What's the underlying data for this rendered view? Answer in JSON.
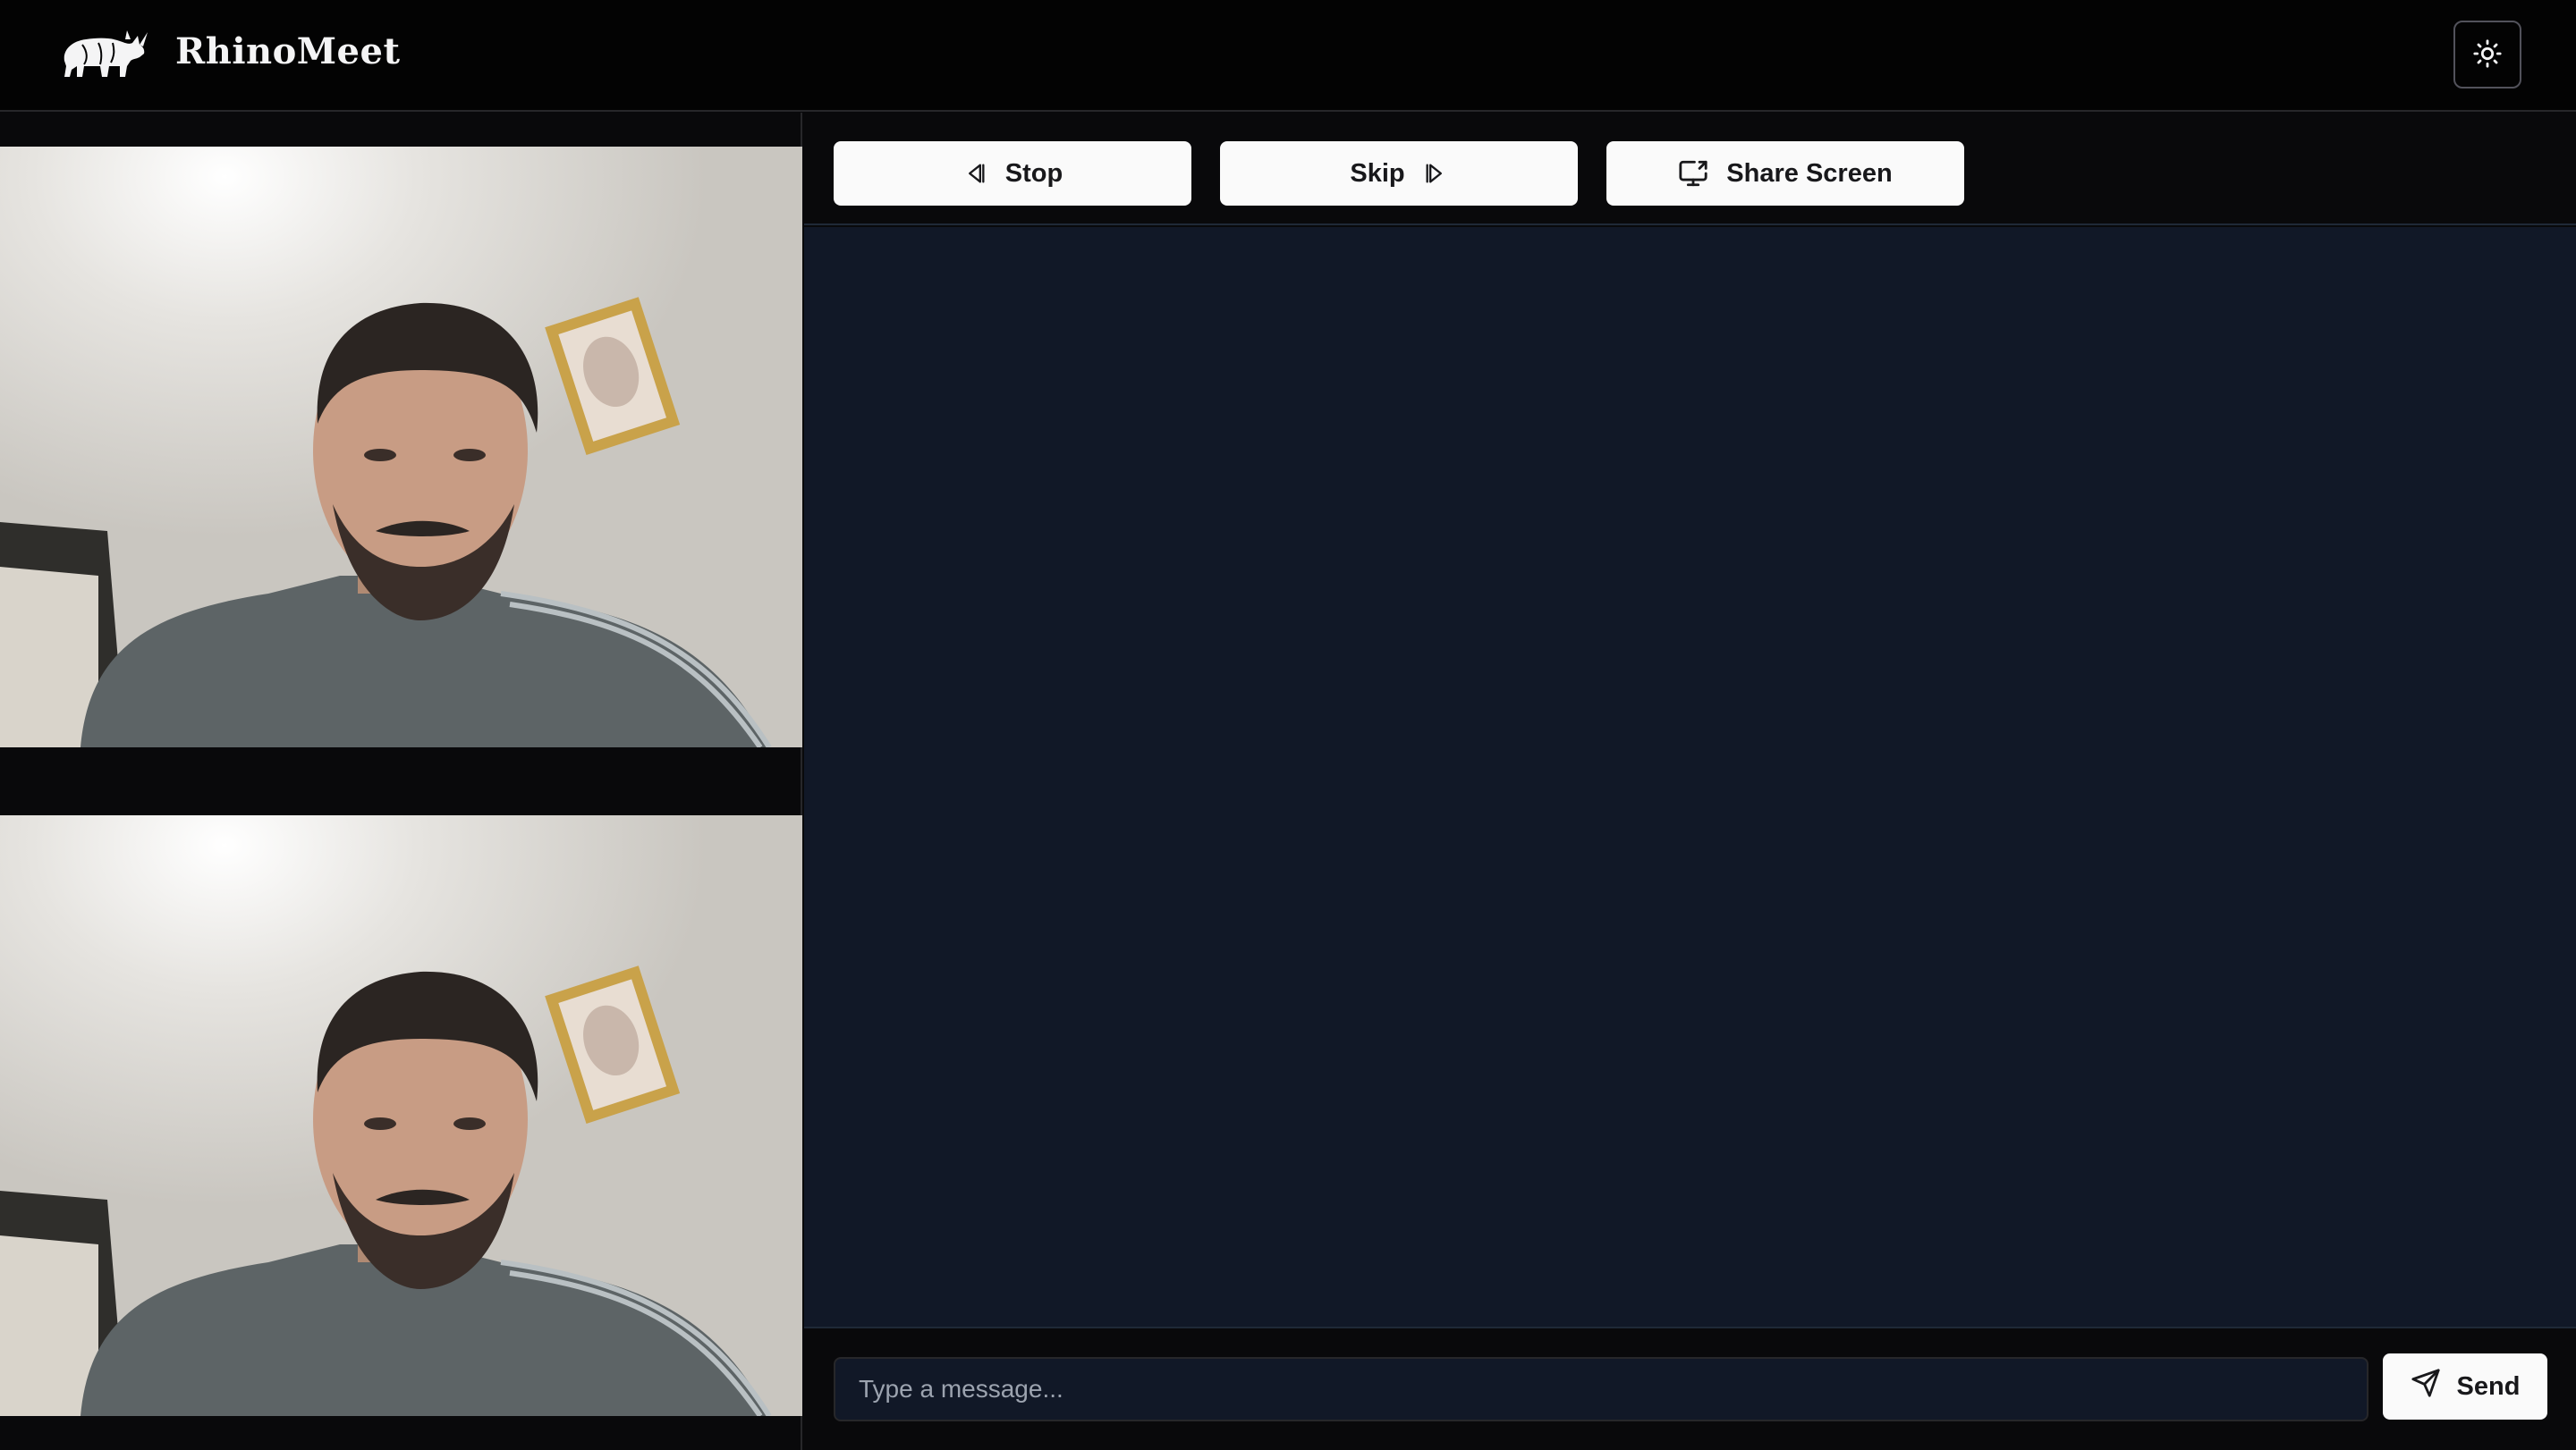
{
  "header": {
    "brand": "RhinoMeet",
    "logo_icon": "rhino-logo-icon",
    "theme_toggle_icon": "sun-icon"
  },
  "videos": [
    {
      "name": "remote-video",
      "subject": "person-webcam-feed"
    },
    {
      "name": "local-video",
      "subject": "person-webcam-feed"
    }
  ],
  "toolbar": {
    "stop_label": "Stop",
    "stop_icon": "step-back-icon",
    "skip_label": "Skip",
    "skip_icon": "step-forward-icon",
    "share_label": "Share Screen",
    "share_icon": "screen-share-icon"
  },
  "chat": {
    "messages": []
  },
  "composer": {
    "placeholder": "Type a message...",
    "value": "",
    "send_label": "Send",
    "send_icon": "send-icon"
  },
  "colors": {
    "header_bg": "#030303",
    "page_bg": "#09090b",
    "chat_bg": "#111827",
    "button_bg": "#fafafa",
    "button_text": "#18181b"
  }
}
